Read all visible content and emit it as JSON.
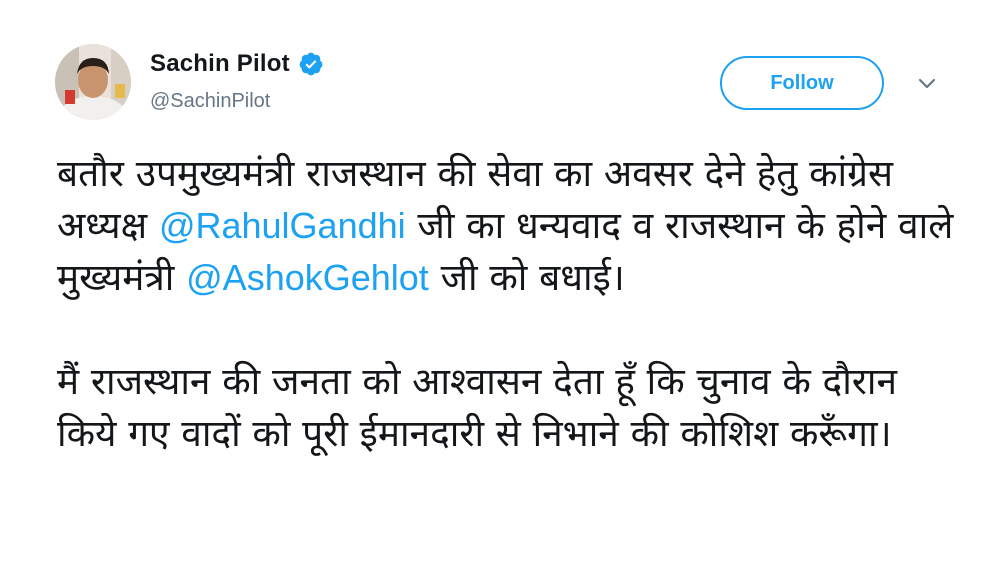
{
  "author": {
    "display_name": "Sachin Pilot",
    "handle": "@SachinPilot",
    "verified": true
  },
  "actions": {
    "follow_label": "Follow"
  },
  "colors": {
    "link": "#1da1f2",
    "verified": "#1da1f2",
    "text": "#14171a",
    "secondary_text": "#657786"
  },
  "icons": {
    "verified": "verified-badge-icon",
    "menu": "chevron-down-icon"
  },
  "tweet": {
    "para1": {
      "part1": "बतौर उपमुख्यमंत्री राजस्थान की सेवा का अवसर देने हेतु कांग्रेस अध्यक्ष ",
      "mention1": "@RahulGandhi",
      "part2": " जी का धन्यवाद व राजस्थान के होने वाले मुख्यमंत्री ",
      "mention2": "@AshokGehlot",
      "part3": " जी को बधाई।"
    },
    "para2": "मैं राजस्थान की जनता को आश्वासन देता हूँ कि चुनाव के दौरान किये गए वादों को पूरी ईमानदारी से निभाने की कोशिश करूँगा।"
  }
}
